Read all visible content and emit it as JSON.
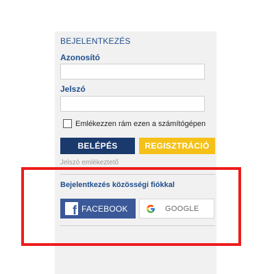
{
  "login": {
    "title": "BEJELENTKEZÉS",
    "id_label": "Azonosító",
    "password_label": "Jelszó",
    "remember_label": "Emlékezzen rám ezen a számítógépen",
    "remember_checked": false,
    "login_button": "BELÉPÉS",
    "register_button": "REGISZTRÁCIÓ",
    "forgot_link": "Jelszó emlékeztető"
  },
  "social": {
    "title": "Bejelentkezés közösségi fiókkal",
    "facebook_label": "FACEBOOK",
    "google_label": "GOOGLE"
  },
  "colors": {
    "primary_blue": "#1a3a6e",
    "accent_yellow": "#f5c118",
    "facebook_blue": "#3b5998",
    "highlight_red": "#ee1c1c",
    "label_blue": "#1f4e8c"
  },
  "icons": {
    "facebook": "facebook-icon",
    "google": "google-icon"
  }
}
